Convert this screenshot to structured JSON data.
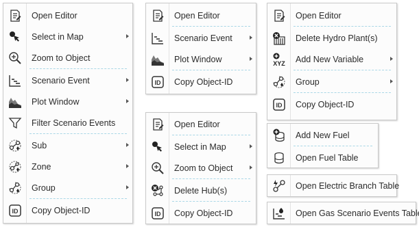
{
  "menus": {
    "m1": {
      "items": [
        {
          "label": "Open Editor",
          "icon": "edit-document-icon"
        },
        {
          "label": "Select in Map",
          "icon": "select-cursor-icon"
        },
        {
          "label": "Zoom to Object",
          "icon": "zoom-magnifier-icon"
        },
        {
          "label": "Scenario Event",
          "icon": "scenario-event-icon"
        },
        {
          "label": "Plot Window",
          "icon": "area-plot-icon"
        },
        {
          "label": "Filter Scenario Events",
          "icon": "funnel-filter-icon"
        },
        {
          "label": "Sub",
          "icon": "sub-network-icon"
        },
        {
          "label": "Zone",
          "icon": "zone-network-icon"
        },
        {
          "label": "Group",
          "icon": "group-network-icon"
        },
        {
          "label": "Copy Object-ID",
          "icon": "id-badge-icon"
        }
      ]
    },
    "m2": {
      "items": [
        {
          "label": "Open Editor",
          "icon": "edit-document-icon"
        },
        {
          "label": "Scenario Event",
          "icon": "scenario-event-icon"
        },
        {
          "label": "Plot Window",
          "icon": "area-plot-icon"
        },
        {
          "label": "Copy Object-ID",
          "icon": "id-badge-icon"
        }
      ]
    },
    "m3": {
      "items": [
        {
          "label": "Open Editor",
          "icon": "edit-document-icon"
        },
        {
          "label": "Select in Map",
          "icon": "select-cursor-icon"
        },
        {
          "label": "Zoom to Object",
          "icon": "zoom-magnifier-icon"
        },
        {
          "label": "Delete Hub(s)",
          "icon": "delete-hub-icon"
        },
        {
          "label": "Copy Object-ID",
          "icon": "id-badge-icon"
        }
      ]
    },
    "m4": {
      "items": [
        {
          "label": "Open Editor",
          "icon": "edit-document-icon"
        },
        {
          "label": "Delete Hydro Plant(s)",
          "icon": "delete-hydro-plant-icon"
        },
        {
          "label": "Add New Variable",
          "icon": "add-variable-xyz-icon",
          "icon_text": "XYZ"
        },
        {
          "label": "Group",
          "icon": "group-network-icon"
        },
        {
          "label": "Copy Object-ID",
          "icon": "id-badge-icon"
        }
      ]
    },
    "m5": {
      "items": [
        {
          "label": "Add New Fuel",
          "icon": "add-fuel-icon"
        },
        {
          "label": "Open Fuel Table",
          "icon": "fuel-table-icon"
        }
      ]
    },
    "m6": {
      "items": [
        {
          "label": "Open Electric Branch Table",
          "icon": "electric-branch-icon"
        }
      ]
    },
    "m7": {
      "items": [
        {
          "label": "Open Gas Scenario Events Table",
          "icon": "gas-scenario-events-icon"
        }
      ]
    }
  },
  "colors": {
    "accent_separator": "#a9d7e6",
    "menu_border": "#c9c9c9",
    "text": "#2b2b2b"
  }
}
